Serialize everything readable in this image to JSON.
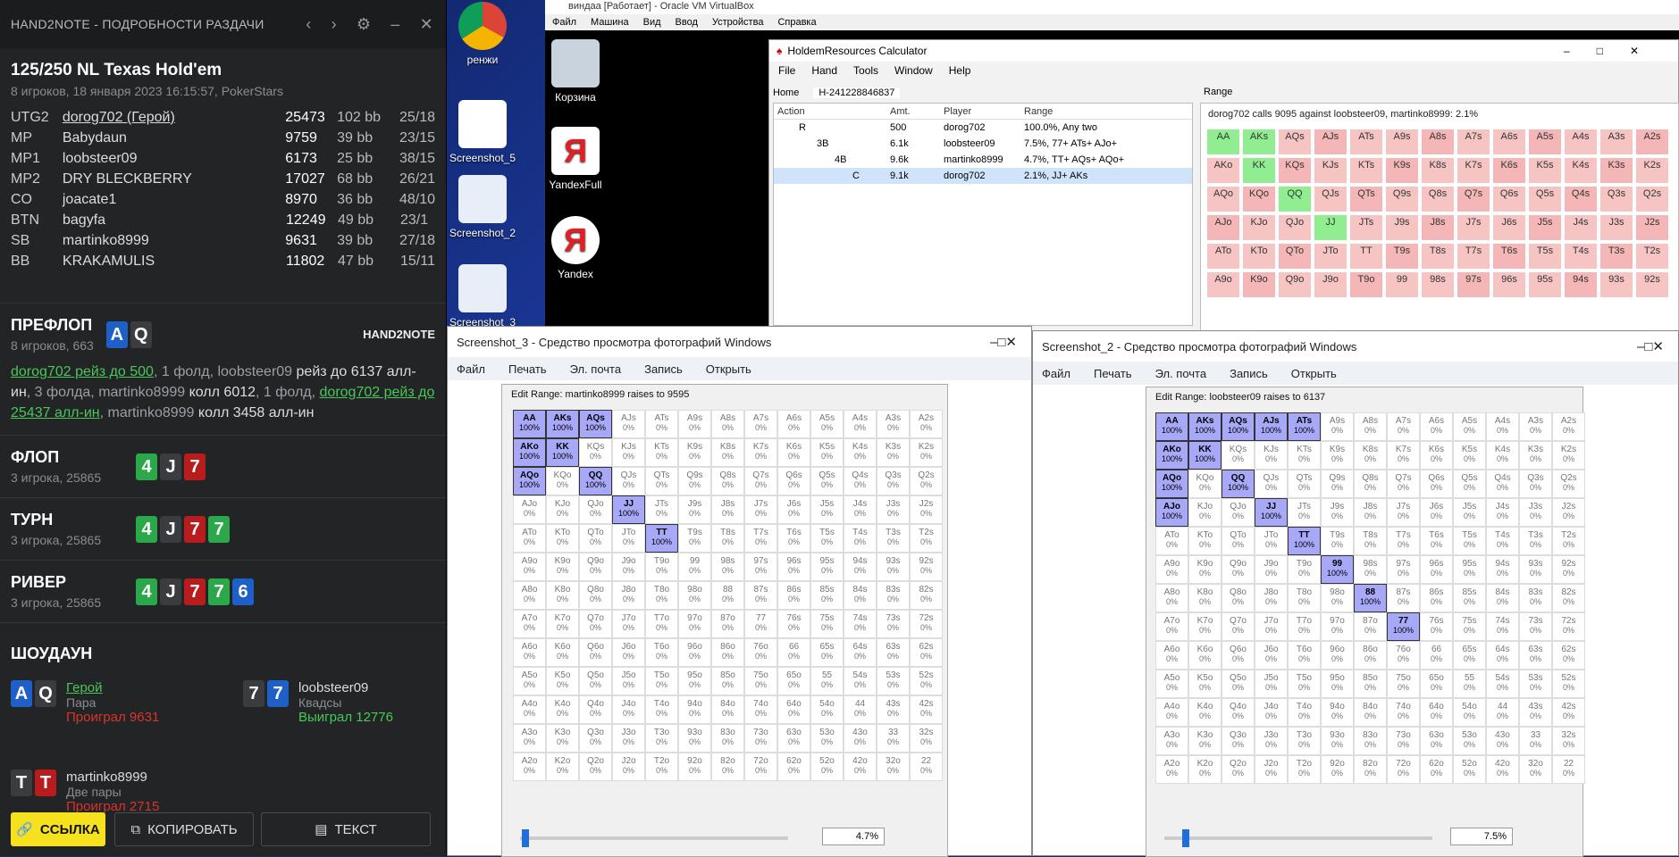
{
  "h2n": {
    "header": "HAND2NOTE - ПОДРОБНОСТИ РАЗДАЧИ",
    "title": "125/250 NL Texas Hold'em",
    "subtitle": "8 игроков, 18 января 2023 16:15:57, PokerStars",
    "players": [
      {
        "pos": "UTG2",
        "name": "dorog702 (Герой)",
        "stack": "25473",
        "bb": "102 bb",
        "vp": "25/18",
        "hero": true
      },
      {
        "pos": "MP",
        "name": "Babydaun",
        "stack": "9759",
        "bb": "39 bb",
        "vp": "23/15"
      },
      {
        "pos": "MP1",
        "name": "loobsteer09",
        "stack": "6173",
        "bb": "25 bb",
        "vp": "38/15"
      },
      {
        "pos": "MP2",
        "name": "DRY BLECKBERRY",
        "stack": "17027",
        "bb": "68 bb",
        "vp": "26/21"
      },
      {
        "pos": "CO",
        "name": "joacate1",
        "stack": "8970",
        "bb": "36 bb",
        "vp": "48/10"
      },
      {
        "pos": "BTN",
        "name": "bagyfa",
        "stack": "12249",
        "bb": "49 bb",
        "vp": "23/1"
      },
      {
        "pos": "SB",
        "name": "martinko8999",
        "stack": "9631",
        "bb": "39 bb",
        "vp": "27/18"
      },
      {
        "pos": "BB",
        "name": "KRAKAMULIS",
        "stack": "11802",
        "bb": "47 bb",
        "vp": "15/11"
      }
    ],
    "preflop": {
      "title": "ПРЕФЛОП",
      "sub": "8 игроков, 663",
      "brand": "HAND2NOTE",
      "a1": "dorog702 рейз до 500",
      "a2": ", 1 фолд, loobsteer09 ",
      "a3": "рейз до 6137 алл-ин",
      "a4": ", 3 фолда, martinko8999 ",
      "a5": "колл 6012",
      "a6": ", 1 фолд, ",
      "a7": "dorog702 рейз до 25437 алл-ин",
      "a8": ", martinko8999 ",
      "a9": "колл 3458 алл-ин"
    },
    "flop": {
      "title": "ФЛОП",
      "sub": "3 игрока, 25865"
    },
    "turn": {
      "title": "ТУРН",
      "sub": "3 игрока, 25865"
    },
    "river": {
      "title": "РИВЕР",
      "sub": "3 игрока, 25865"
    },
    "showdown": {
      "title": "ШОУДАУН",
      "p1": {
        "name": "Герой",
        "hand": "Пара",
        "res": "Проиграл 9631"
      },
      "p2": {
        "name": "loobsteer09",
        "hand": "Квадсы",
        "res": "Выиграл 12776"
      },
      "p3": {
        "name": "martinko8999",
        "hand": "Две пары",
        "res": "Проиграл 2715"
      }
    },
    "buttons": {
      "link": "ССЫЛКА",
      "copy": "КОПИРОВАТЬ",
      "text": "ТЕКСТ"
    }
  },
  "desktop": {
    "icons": [
      "ренжи",
      "Screenshot_5",
      "Screenshot_2",
      "Screenshot_3",
      "Корзина",
      "YandexFull",
      "Yandex"
    ]
  },
  "vbox": {
    "title": "виндаа [Работает] - Oracle VM VirtualBox",
    "menu": [
      "Файл",
      "Машина",
      "Вид",
      "Ввод",
      "Устройства",
      "Справка"
    ]
  },
  "calc": {
    "title": "HoldemResources Calculator",
    "menu": [
      "File",
      "Hand",
      "Tools",
      "Window",
      "Help"
    ],
    "tabs": [
      "Home",
      "H-241228846837"
    ],
    "cols": [
      "Action",
      "Amt.",
      "Player",
      "Range"
    ],
    "rows": [
      [
        "R",
        "500",
        "dorog702",
        "100.0%, Any two"
      ],
      [
        "3B",
        "6.1k",
        "loobsteer09",
        "7.5%, 77+ ATs+ AJo+"
      ],
      [
        "4B",
        "9.6k",
        "martinko8999",
        "4.7%, TT+ AQs+ AQo+"
      ],
      [
        "C",
        "9.1k",
        "dorog702",
        "2.1%, JJ+ AKs"
      ]
    ],
    "range_tab": "Range",
    "range_title": "dorog702 calls 9095 against loobsteer09, martinko8999: 2.1%"
  },
  "pv1": {
    "title": "Screenshot_3 - Средство просмотра фотографий Windows",
    "tools": [
      "Файл",
      "Печать",
      "Эл. почта",
      "Запись",
      "Открыть"
    ],
    "dlg": "Edit Range: martinko8999 raises to 9595",
    "pct": "4.7%"
  },
  "pv2": {
    "title": "Screenshot_2 - Средство просмотра фотографий Windows",
    "tools": [
      "Файл",
      "Печать",
      "Эл. почта",
      "Запись",
      "Открыть"
    ],
    "dlg": "Edit Range: loobsteer09 raises to 6137",
    "pct": "7.5%"
  },
  "colors": {
    "green": "#49c759",
    "red": "#d9342b",
    "select": "#a8a8f8"
  }
}
